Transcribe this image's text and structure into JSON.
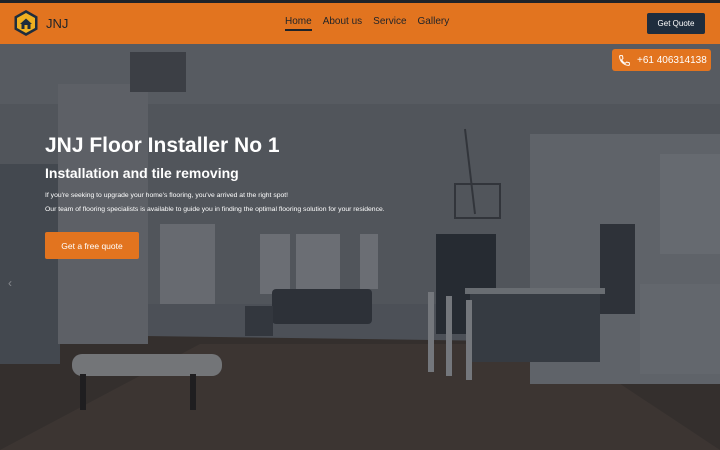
{
  "brand": {
    "name": "JNJ",
    "logo_icon": "house-hexagon-icon"
  },
  "nav": {
    "links": [
      {
        "label": "Home",
        "active": true
      },
      {
        "label": "About us",
        "active": false
      },
      {
        "label": "Gallery",
        "active": false
      }
    ],
    "service_label": "Service"
  },
  "header": {
    "quote_label": "Get Quote"
  },
  "phone": {
    "icon": "phone-icon",
    "number": "+61 406314138"
  },
  "hero": {
    "title": "JNJ Floor Installer No 1",
    "subtitle": "Installation and tile removing",
    "line1": "If you're seeking to upgrade your home's flooring, you've arrived at the right spot!",
    "line2": "Our team of flooring specialists is available to guide you in finding the optimal flooring solution for your residence.",
    "cta_label": "Get a free quote",
    "prev_arrow": "‹"
  },
  "colors": {
    "accent": "#e2741f",
    "dark": "#1f2d3d",
    "overlay": "#161a20"
  }
}
